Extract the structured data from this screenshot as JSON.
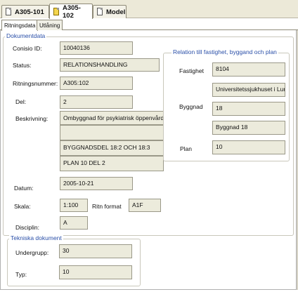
{
  "doc_tabs": [
    "A305-101",
    "A305-102",
    "Model"
  ],
  "inner_tabs": [
    "Ritningsdata",
    "Utlåning"
  ],
  "dokumentdata": {
    "legend": "Dokumentdata",
    "conisio_id_label": "Conisio ID:",
    "conisio_id": "10040136",
    "status_label": "Status:",
    "status": "RELATIONSHANDLING",
    "ritningsnummer_label": "Ritningsnummer:",
    "ritningsnummer": "A305:102",
    "del_label": "Del:",
    "del": "2",
    "beskrivning_label": "Beskrivning:",
    "beskrivning": [
      "Ombyggnad för psykiatrisk öppenvård",
      "",
      "BYGGNADSDEL 18:2 OCH 18:3",
      "PLAN 10 DEL 2"
    ],
    "datum_label": "Datum:",
    "datum": "2005-10-21",
    "skala_label": "Skala:",
    "skala": "1:100",
    "ritn_format_label": "Ritn format",
    "ritn_format": "A1F",
    "disciplin_label": "Disciplin:",
    "disciplin": "A"
  },
  "relation": {
    "legend": "Relation till fastighet, byggand och plan",
    "fastighet_label": "Fastighet",
    "fastighet": "8104",
    "fastighet_name": "Universitetssjukhuset i Lund",
    "byggnad_label": "Byggnad",
    "byggnad": "18",
    "byggnad_name": "Byggnad 18",
    "plan_label": "Plan",
    "plan": "10"
  },
  "tekniska": {
    "legend": "Tekniska dokument",
    "undergrupp_label": "Undergrupp:",
    "undergrupp": "30",
    "typ_label": "Typ:",
    "typ": "10"
  }
}
